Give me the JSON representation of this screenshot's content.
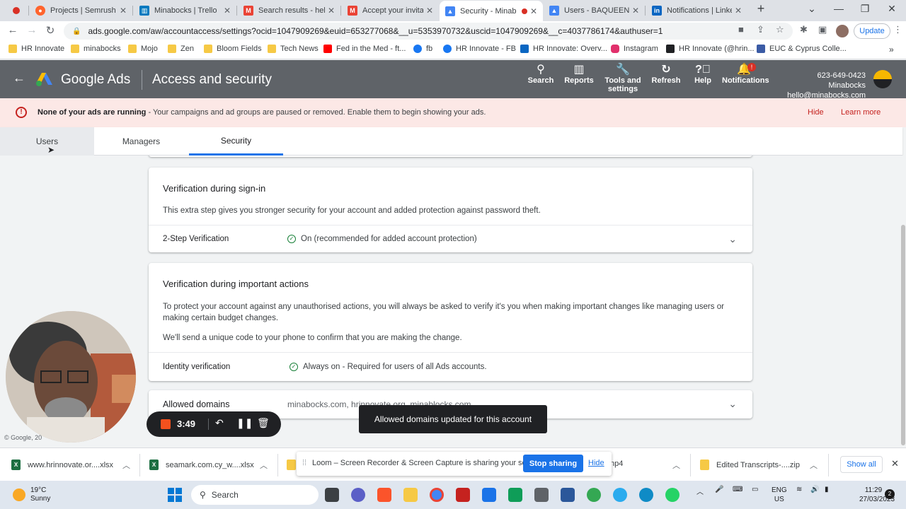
{
  "browser": {
    "tabs": [
      {
        "title": "",
        "icon": "recording-icon",
        "color": "#d93025"
      },
      {
        "title": "Projects | Semrush",
        "icon": "semrush-icon",
        "color": "#ff642d"
      },
      {
        "title": "Minabocks | Trello",
        "icon": "trello-icon",
        "color": "#0079bf"
      },
      {
        "title": "Search results - hello",
        "icon": "gmail-icon",
        "color": "#ea4335"
      },
      {
        "title": "Accept your invitation",
        "icon": "gmail-icon",
        "color": "#ea4335"
      },
      {
        "title": "Security - Minab",
        "icon": "google-ads-icon",
        "color": "#4285f4"
      },
      {
        "title": "Users - BAQUEENO",
        "icon": "google-ads-icon",
        "color": "#4285f4"
      },
      {
        "title": "Notifications | Linked",
        "icon": "linkedin-icon",
        "color": "#0a66c2"
      }
    ],
    "url": "ads.google.com/aw/accountaccess/settings?ocid=1047909269&euid=653277068&__u=5353970732&uscid=1047909269&__c=4037786174&authuser=1",
    "update_label": "Update",
    "bookmarks": [
      {
        "label": "HR Innovate",
        "color": "#f6c945"
      },
      {
        "label": "minabocks",
        "color": "#f6c945"
      },
      {
        "label": "Mojo",
        "color": "#f6c945"
      },
      {
        "label": "Zen",
        "color": "#f6c945"
      },
      {
        "label": "Bloom Fields",
        "color": "#f6c945"
      },
      {
        "label": "Tech News",
        "color": "#f6c945"
      },
      {
        "label": "Fed in the Med - ft...",
        "color": "#ff0000"
      },
      {
        "label": "fb",
        "color": "#1877f2"
      },
      {
        "label": "HR Innovate - FB",
        "color": "#1877f2"
      },
      {
        "label": "HR Innovate: Overv...",
        "color": "#0a66c2"
      },
      {
        "label": "Instagram",
        "color": "#e1306c"
      },
      {
        "label": "HR Innovate (@hrin...",
        "color": "#202124"
      },
      {
        "label": "EUC & Cyprus Colle...",
        "color": "#3b5ba5"
      }
    ]
  },
  "header": {
    "product": "Google Ads",
    "page_title": "Access and security",
    "buttons": {
      "search": "Search",
      "reports": "Reports",
      "tools_line1": "Tools and",
      "tools_line2": "settings",
      "refresh": "Refresh",
      "help": "Help",
      "notifications": "Notifications"
    },
    "notif_badge": "!",
    "account_phone": "623-649-0423 Minabocks",
    "account_email": "hello@minabocks.com"
  },
  "banner": {
    "title": "None of your ads are running",
    "message": " - Your campaigns and ad groups are paused or removed. Enable them to begin showing your ads.",
    "hide": "Hide",
    "learn_more": "Learn more"
  },
  "subtabs": {
    "users": "Users",
    "managers": "Managers",
    "security": "Security"
  },
  "cards": {
    "signin": {
      "title": "Verification during sign-in",
      "desc": "This extra step gives you stronger security for your account and added protection against password theft.",
      "row_label": "2-Step Verification",
      "row_value": "On (recommended for added account protection)"
    },
    "important": {
      "title": "Verification during important actions",
      "desc1": "To protect your account against any unauthorised actions, you will always be asked to verify it's you when making important changes like managing users or making certain budget changes.",
      "desc2": "We'll send a unique code to your phone to confirm that you are making the change.",
      "row_label": "Identity verification",
      "row_value": "Always on - Required for users of all Ads accounts."
    },
    "domains": {
      "title": "Allowed domains",
      "value": "minabocks.com, hrinnovate.org, minablocks.com"
    }
  },
  "toast": "Allowed domains updated for this account",
  "copyright": "© Google, 20",
  "loom": {
    "timer": "3:49",
    "share_message": "Loom – Screen Recorder & Screen Capture is sharing your screen.",
    "stop_sharing": "Stop sharing",
    "hide": "Hide"
  },
  "downloads": {
    "items": [
      {
        "name": "www.hrinnovate.or....xlsx",
        "icon": "excel-icon",
        "color": "#1d6f42"
      },
      {
        "name": "seamark.com.cy_w....xlsx",
        "icon": "excel-icon",
        "color": "#1d6f42"
      },
      {
        "name": "",
        "icon": "folder-icon",
        "color": "#f6c945"
      },
      {
        "name": "np4",
        "icon": "video-icon",
        "color": "#5f6368"
      },
      {
        "name": "Edited Transcripts-....zip",
        "icon": "zip-icon",
        "color": "#f6c945"
      }
    ],
    "show_all": "Show all"
  },
  "taskbar": {
    "temperature": "19°C",
    "condition": "Sunny",
    "search_placeholder": "Search",
    "lang_line1": "ENG",
    "lang_line2": "US",
    "time": "11:29",
    "date": "27/03/2023",
    "notification_count": "2"
  }
}
